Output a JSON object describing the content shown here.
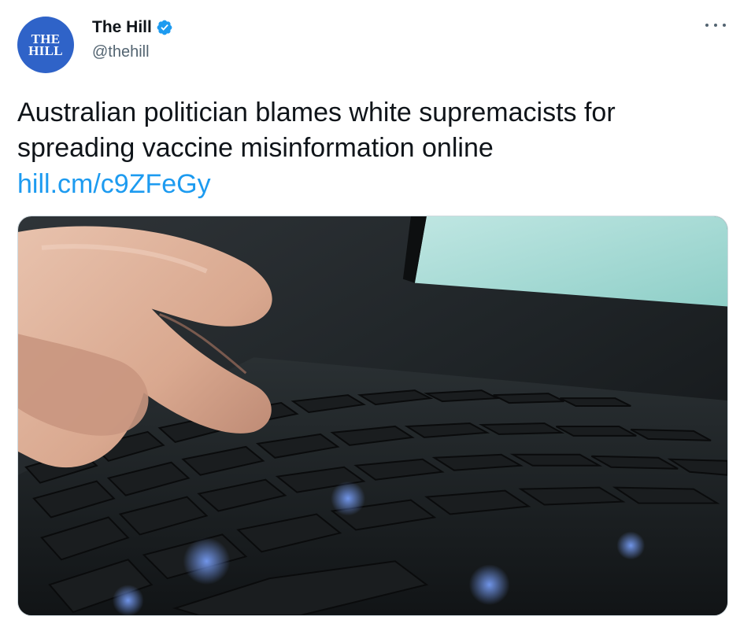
{
  "author": {
    "logo_line1": "THE",
    "logo_line2": "HILL",
    "display_name": "The Hill",
    "handle": "@thehill",
    "verified_icon": "verified-badge-icon",
    "colors": {
      "avatar_bg": "#2f63c8",
      "verified": "#1d9bf0"
    }
  },
  "menu": {
    "icon": "more-options-icon"
  },
  "tweet": {
    "text": "Australian politician blames white supremacists for spreading vaccine misinformation online",
    "link": "hill.cm/c9ZFeGy",
    "colors": {
      "link": "#1d9bf0"
    }
  },
  "media": {
    "subject": "hand-typing-on-laptop-keyboard-photo"
  }
}
